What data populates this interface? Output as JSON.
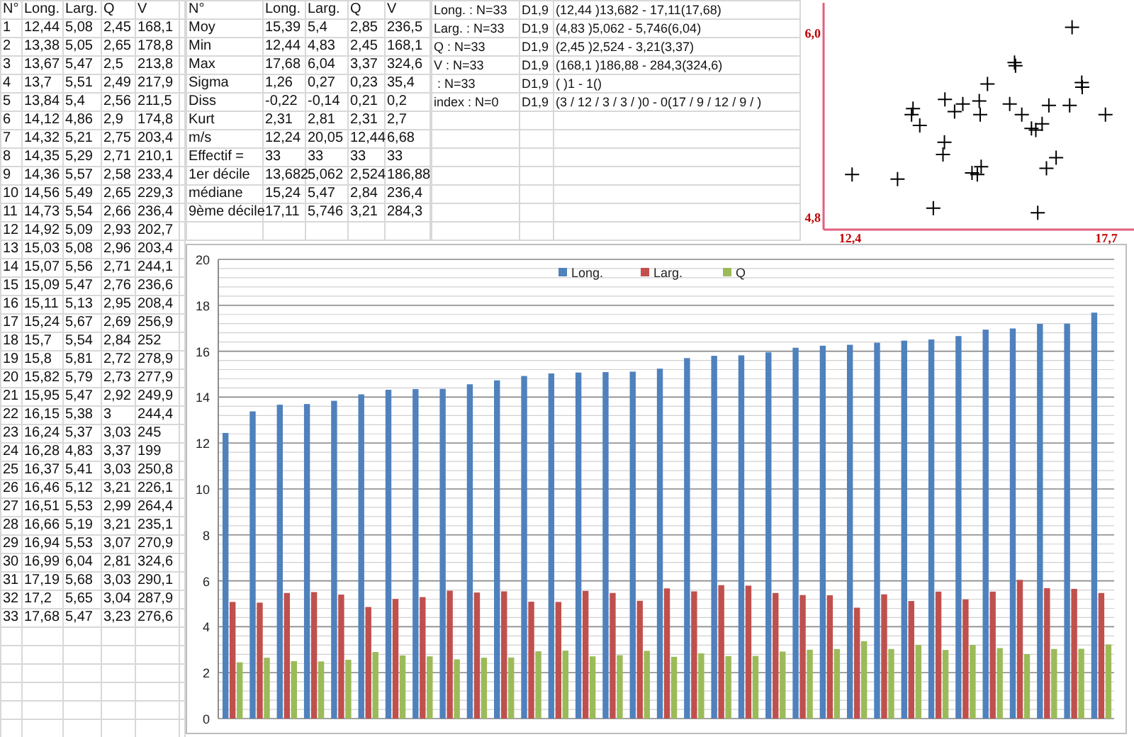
{
  "data_table": {
    "columns": [
      "N°",
      "Long.",
      "Larg.",
      "Q",
      "V"
    ],
    "rows": [
      [
        "1",
        "12,44",
        "5,08",
        "2,45",
        "168,1"
      ],
      [
        "2",
        "13,38",
        "5,05",
        "2,65",
        "178,8"
      ],
      [
        "3",
        "13,67",
        "5,47",
        "2,5",
        "213,8"
      ],
      [
        "4",
        "13,7",
        "5,51",
        "2,49",
        "217,9"
      ],
      [
        "5",
        "13,84",
        "5,4",
        "2,56",
        "211,5"
      ],
      [
        "6",
        "14,12",
        "4,86",
        "2,9",
        "174,8"
      ],
      [
        "7",
        "14,32",
        "5,21",
        "2,75",
        "203,4"
      ],
      [
        "8",
        "14,35",
        "5,29",
        "2,71",
        "210,1"
      ],
      [
        "9",
        "14,36",
        "5,57",
        "2,58",
        "233,4"
      ],
      [
        "10",
        "14,56",
        "5,49",
        "2,65",
        "229,3"
      ],
      [
        "11",
        "14,73",
        "5,54",
        "2,66",
        "236,4"
      ],
      [
        "12",
        "14,92",
        "5,09",
        "2,93",
        "202,7"
      ],
      [
        "13",
        "15,03",
        "5,08",
        "2,96",
        "203,4"
      ],
      [
        "14",
        "15,07",
        "5,56",
        "2,71",
        "244,1"
      ],
      [
        "15",
        "15,09",
        "5,47",
        "2,76",
        "236,6"
      ],
      [
        "16",
        "15,11",
        "5,13",
        "2,95",
        "208,4"
      ],
      [
        "17",
        "15,24",
        "5,67",
        "2,69",
        "256,9"
      ],
      [
        "18",
        "15,7",
        "5,54",
        "2,84",
        "252"
      ],
      [
        "19",
        "15,8",
        "5,81",
        "2,72",
        "278,9"
      ],
      [
        "20",
        "15,82",
        "5,79",
        "2,73",
        "277,9"
      ],
      [
        "21",
        "15,95",
        "5,47",
        "2,92",
        "249,9"
      ],
      [
        "22",
        "16,15",
        "5,38",
        "3",
        "244,4"
      ],
      [
        "23",
        "16,24",
        "5,37",
        "3,03",
        "245"
      ],
      [
        "24",
        "16,28",
        "4,83",
        "3,37",
        "199"
      ],
      [
        "25",
        "16,37",
        "5,41",
        "3,03",
        "250,8"
      ],
      [
        "26",
        "16,46",
        "5,12",
        "3,21",
        "226,1"
      ],
      [
        "27",
        "16,51",
        "5,53",
        "2,99",
        "264,4"
      ],
      [
        "28",
        "16,66",
        "5,19",
        "3,21",
        "235,1"
      ],
      [
        "29",
        "16,94",
        "5,53",
        "3,07",
        "270,9"
      ],
      [
        "30",
        "16,99",
        "6,04",
        "2,81",
        "324,6"
      ],
      [
        "31",
        "17,19",
        "5,68",
        "3,03",
        "290,1"
      ],
      [
        "32",
        "17,2",
        "5,65",
        "3,04",
        "287,9"
      ],
      [
        "33",
        "17,68",
        "5,47",
        "3,23",
        "276,6"
      ]
    ]
  },
  "stats_table": {
    "columns": [
      "N°",
      "Long.",
      "Larg.",
      "Q",
      "V"
    ],
    "rows": [
      [
        "Moy",
        "15,39",
        "5,4",
        "2,85",
        "236,5"
      ],
      [
        "Min",
        "12,44",
        "4,83",
        "2,45",
        "168,1"
      ],
      [
        "Max",
        "17,68",
        "6,04",
        "3,37",
        "324,6"
      ],
      [
        "Sigma",
        "1,26",
        "0,27",
        "0,23",
        "35,4"
      ],
      [
        "Diss",
        "-0,22",
        "-0,14",
        "0,21",
        "0,2"
      ],
      [
        "Kurt",
        "2,31",
        "2,81",
        "2,31",
        "2,7"
      ],
      [
        "m/s",
        "12,24",
        "20,05",
        "12,44",
        "6,68"
      ],
      [
        "Effectif =",
        "33",
        "33",
        "33",
        "33"
      ],
      [
        "1er décile",
        "13,682",
        "5,062",
        "2,524",
        "186,88"
      ],
      [
        "médiane",
        "15,24",
        "5,47",
        "2,84",
        "236,4"
      ],
      [
        "9ème décile",
        "17,11",
        "5,746",
        "3,21",
        "284,3"
      ]
    ]
  },
  "summary": [
    [
      "Long. : N=33",
      "D1,9",
      "(12,44 )13,682 - 17,11(17,68)"
    ],
    [
      "Larg. : N=33",
      "D1,9",
      "(4,83 )5,062 - 5,746(6,04)"
    ],
    [
      "Q : N=33",
      "D1,9",
      "(2,45 )2,524 - 3,21(3,37)"
    ],
    [
      "V : N=33",
      "D1,9",
      "(168,1 )186,88 - 284,3(324,6)"
    ],
    [
      " : N=33",
      "D1,9",
      "( )1 - 1()"
    ],
    [
      "index : N=0",
      "D1,9",
      "(3 / 12 / 3 / 3 / )0 - 0(17 / 9 / 12 / 9 / )"
    ]
  ],
  "scatter_chart": {
    "chart_data": {
      "type": "scatter",
      "xlim": [
        11.85,
        18.3
      ],
      "ylim": [
        4.72,
        6.2
      ],
      "xticks": [
        {
          "value": 12.4,
          "label": "12,4"
        },
        {
          "value": 17.7,
          "label": "17,7"
        }
      ],
      "yticks": [
        {
          "value": 4.8,
          "label": "4,8"
        },
        {
          "value": 6.0,
          "label": "6,0"
        }
      ],
      "x": [
        12.44,
        13.38,
        13.67,
        13.7,
        13.84,
        14.12,
        14.32,
        14.35,
        14.36,
        14.56,
        14.73,
        14.92,
        15.03,
        15.07,
        15.09,
        15.11,
        15.24,
        15.7,
        15.8,
        15.82,
        15.95,
        16.15,
        16.24,
        16.28,
        16.37,
        16.46,
        16.51,
        16.66,
        16.94,
        16.99,
        17.19,
        17.2,
        17.68
      ],
      "series": [
        {
          "color": "#000000",
          "values": [
            5.08,
            5.05,
            5.47,
            5.51,
            5.4,
            4.86,
            5.21,
            5.29,
            5.57,
            5.49,
            5.54,
            5.09,
            5.08,
            5.56,
            5.47,
            5.13,
            5.67,
            5.54,
            5.81,
            5.79,
            5.47,
            5.38,
            5.37,
            4.83,
            5.41,
            5.12,
            5.53,
            5.19,
            5.53,
            6.04,
            5.68,
            5.65,
            5.47
          ]
        }
      ]
    }
  },
  "bar_chart": {
    "chart_data": {
      "type": "bar",
      "grid": true,
      "legend": "top",
      "ylim": [
        0,
        20
      ],
      "yticks": [
        0,
        2,
        4,
        6,
        8,
        10,
        12,
        14,
        16,
        18,
        20
      ],
      "series": [
        {
          "name": "Long.",
          "color": "#4f81bd",
          "values": [
            12.44,
            13.38,
            13.67,
            13.7,
            13.84,
            14.12,
            14.32,
            14.35,
            14.36,
            14.56,
            14.73,
            14.92,
            15.03,
            15.07,
            15.09,
            15.11,
            15.24,
            15.7,
            15.8,
            15.82,
            15.95,
            16.15,
            16.24,
            16.28,
            16.37,
            16.46,
            16.51,
            16.66,
            16.94,
            16.99,
            17.19,
            17.2,
            17.68
          ]
        },
        {
          "name": "Larg.",
          "color": "#c0504d",
          "values": [
            5.08,
            5.05,
            5.47,
            5.51,
            5.4,
            4.86,
            5.21,
            5.29,
            5.57,
            5.49,
            5.54,
            5.09,
            5.08,
            5.56,
            5.47,
            5.13,
            5.67,
            5.54,
            5.81,
            5.79,
            5.47,
            5.38,
            5.37,
            4.83,
            5.41,
            5.12,
            5.53,
            5.19,
            5.53,
            6.04,
            5.68,
            5.65,
            5.47
          ]
        },
        {
          "name": "Q",
          "color": "#9bbb59",
          "values": [
            2.45,
            2.65,
            2.5,
            2.49,
            2.56,
            2.9,
            2.75,
            2.71,
            2.58,
            2.65,
            2.66,
            2.93,
            2.96,
            2.71,
            2.76,
            2.95,
            2.69,
            2.84,
            2.72,
            2.73,
            2.92,
            3,
            3.03,
            3.37,
            3.03,
            3.21,
            2.99,
            3.21,
            3.07,
            2.81,
            3.03,
            3.04,
            3.23
          ]
        }
      ]
    }
  }
}
